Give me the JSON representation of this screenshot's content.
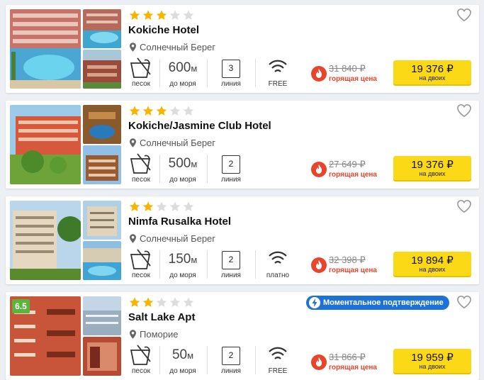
{
  "hotels": [
    {
      "stars": 3,
      "name": "Kokiche Hotel",
      "location": "Солнечный Берег",
      "beach_label": "песок",
      "distance_value": "600",
      "distance_unit": "м",
      "distance_label": "до моря",
      "line_value": "3",
      "line_label": "линия",
      "wifi_label": "FREE",
      "old_price": "31 840 ₽",
      "hot_label": "горящая цена",
      "price": "19 376 ₽",
      "price_sub": "на двоих"
    },
    {
      "stars": 3,
      "name": "Kokiche/Jasmine Club Hotel",
      "location": "Солнечный Берег",
      "beach_label": "песок",
      "distance_value": "500",
      "distance_unit": "м",
      "distance_label": "до моря",
      "line_value": "2",
      "line_label": "линия",
      "old_price": "27 649 ₽",
      "hot_label": "горящая цена",
      "price": "19 376 ₽",
      "price_sub": "на двоих"
    },
    {
      "stars": 2,
      "name": "Nimfa Rusalka Hotel",
      "location": "Солнечный Берег",
      "beach_label": "песок",
      "distance_value": "150",
      "distance_unit": "м",
      "distance_label": "до моря",
      "line_value": "2",
      "line_label": "линия",
      "wifi_label": "платно",
      "old_price": "32 398 ₽",
      "hot_label": "горящая цена",
      "price": "19 894 ₽",
      "price_sub": "на двоих"
    },
    {
      "rating": "6.5",
      "instant_label": "Моментальное подтверждение",
      "stars": 2,
      "name": "Salt Lake Apt",
      "location": "Поморие",
      "beach_label": "песок",
      "distance_value": "50",
      "distance_unit": "м",
      "distance_label": "до моря",
      "line_value": "2",
      "line_label": "линия",
      "wifi_label": "FREE",
      "old_price": "31 866 ₽",
      "hot_label": "горящая цена",
      "price": "19 959 ₽",
      "price_sub": "на двоих"
    }
  ],
  "colors": {
    "star_on": "#f7b500",
    "star_off": "#dcdcdc",
    "button": "#fcd916",
    "hot": "#e8452c",
    "rating": "#5cb43c",
    "instant": "#1e72d6"
  }
}
